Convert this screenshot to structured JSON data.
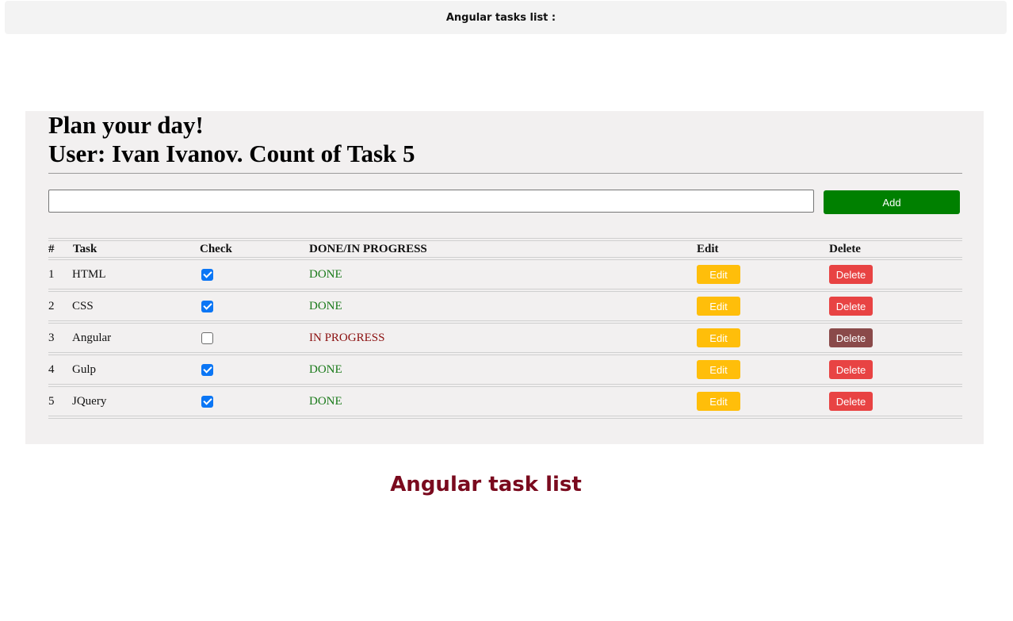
{
  "topbar": {
    "title": "Angular tasks list :"
  },
  "panel": {
    "heading_line1": "Plan your day!",
    "heading_line2": "User: Ivan Ivanov. Count of Task 5",
    "input_value": "",
    "add_label": "Add"
  },
  "table": {
    "headers": {
      "num": "#",
      "task": "Task",
      "check": "Check",
      "status": "DONE/IN PROGRESS",
      "edit": "Edit",
      "delete": "Delete"
    },
    "rows": [
      {
        "num": "1",
        "task": "HTML",
        "checked": true,
        "status": "DONE",
        "edit": "Edit",
        "delete": "Delete"
      },
      {
        "num": "2",
        "task": "CSS",
        "checked": true,
        "status": "DONE",
        "edit": "Edit",
        "delete": "Delete"
      },
      {
        "num": "3",
        "task": "Angular",
        "checked": false,
        "status": "IN PROGRESS",
        "edit": "Edit",
        "delete": "Delete"
      },
      {
        "num": "4",
        "task": "Gulp",
        "checked": true,
        "status": "DONE",
        "edit": "Edit",
        "delete": "Delete"
      },
      {
        "num": "5",
        "task": "JQuery",
        "checked": true,
        "status": "DONE",
        "edit": "Edit",
        "delete": "Delete"
      }
    ]
  },
  "footer": {
    "title": "Angular task list"
  },
  "colors": {
    "add_button": "#008000",
    "edit_button": "#ffbe0a",
    "delete_button": "#e84343",
    "delete_button_hover": "#8a4a4a",
    "done_text": "#1a7a1a",
    "in_progress_text": "#8b0f0f",
    "footer_title": "#7a0a1e",
    "checkbox_checked": "#0b76f5"
  }
}
